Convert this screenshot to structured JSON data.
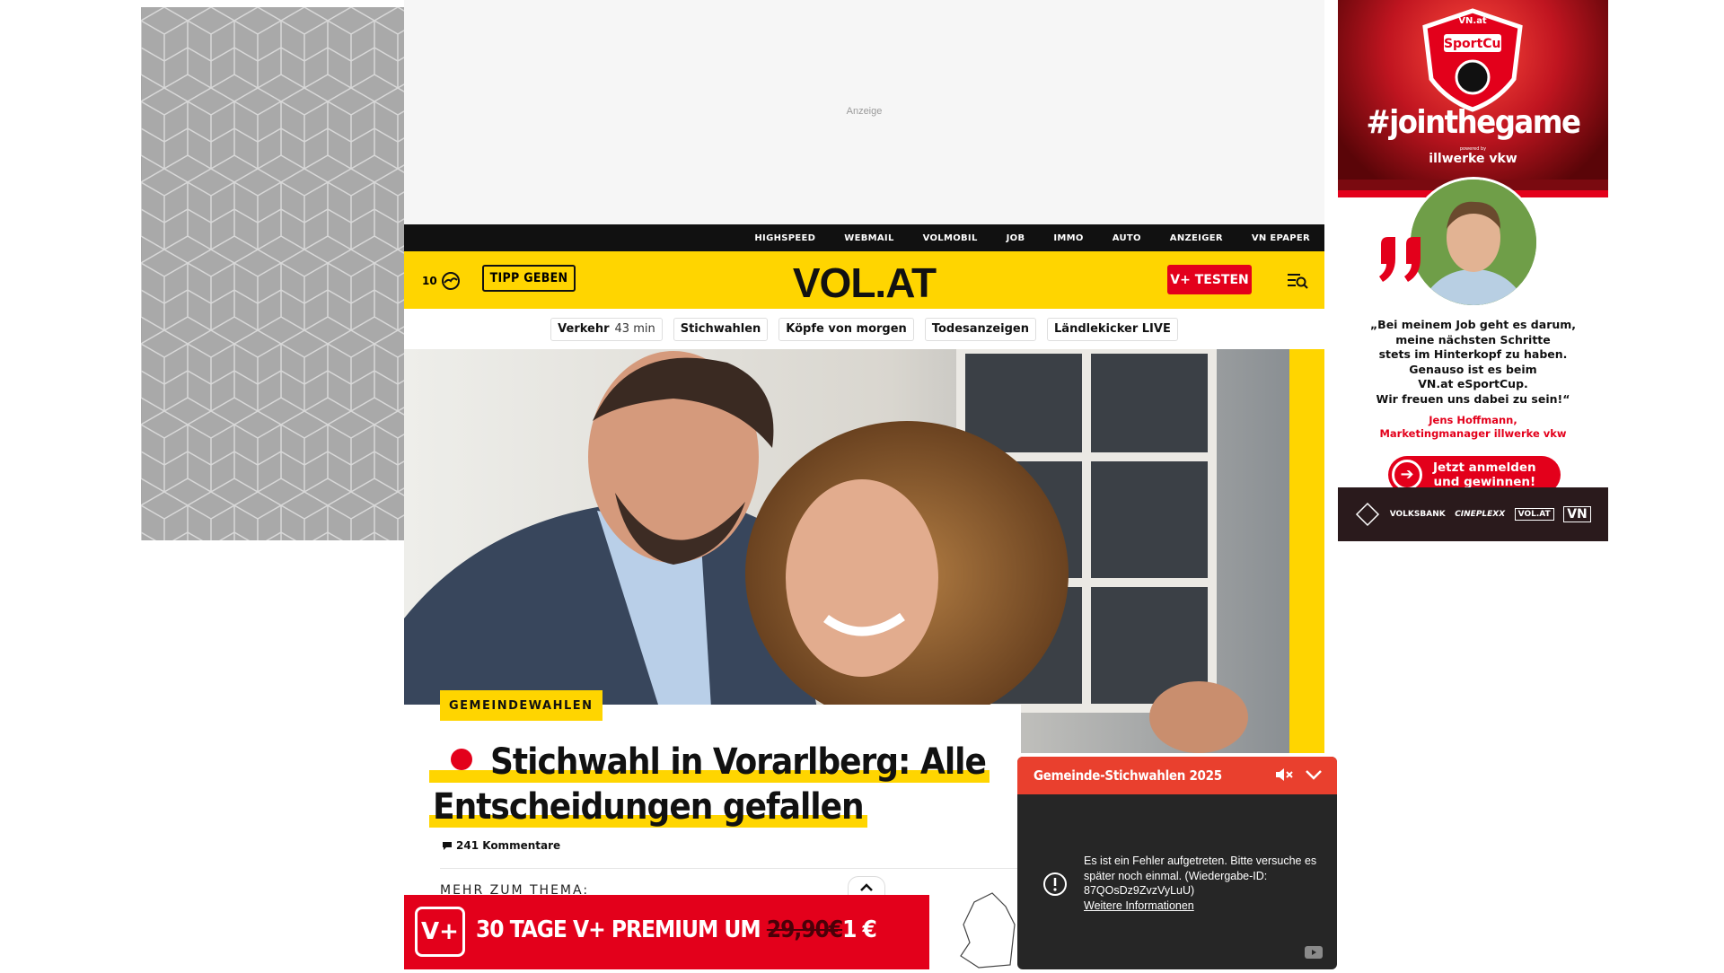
{
  "top_ad": {
    "label": "Anzeige"
  },
  "topnav": {
    "items": [
      "HIGHSPEED",
      "WEBMAIL",
      "VOLMOBIL",
      "JOB",
      "IMMO",
      "AUTO",
      "ANZEIGER",
      "VN EPAPER"
    ]
  },
  "header": {
    "temperature": "10",
    "weather_icon": "cloud-sun-icon",
    "tipp_label": "TIPP GEBEN",
    "logo": "VOL.AT",
    "vplus_label": "V+ TESTEN",
    "menu_icon": "menu-search-icon",
    "brand_yellow": "#ffd500",
    "brand_red": "#e3001b"
  },
  "chips": [
    {
      "label": "Verkehr",
      "sub": "43 min"
    },
    {
      "label": "Stichwahlen",
      "sub": ""
    },
    {
      "label": "Köpfe von morgen",
      "sub": ""
    },
    {
      "label": "Todesanzeigen",
      "sub": ""
    },
    {
      "label": "Ländlekicker LIVE",
      "sub": ""
    }
  ],
  "article": {
    "category": "GEMEINDEWAHLEN",
    "headline_line1": "Stichwahl in Vorarlberg: Alle",
    "headline_line2": "Entscheidungen gefallen",
    "live_indicator_color": "#e3001b",
    "comments": "241 Kommentare",
    "more_topic": "MEHR ZUM THEMA:"
  },
  "promo": {
    "badge": "V+",
    "text_before": "30 TAGE V+ PREMIUM UM ",
    "old_price": "29,90€",
    "new_price": "1 €"
  },
  "right_ad": {
    "brand": "VN.at",
    "event": "eSportCup",
    "hashtag": "#jointhegame",
    "powered_label": "powered by",
    "powered": "illwerke vkw",
    "quote_lines": [
      "„Bei meinem Job geht es darum,",
      "meine nächsten Schritte",
      "stets im Hinterkopf zu haben.",
      "Genauso ist es beim",
      "VN.at eSportCup.",
      "Wir freuen uns dabei zu sein!“"
    ],
    "author_line1": "Jens Hoffmann,",
    "author_line2": "Marketingmanager illwerke vkw",
    "cta_line1": "Jetzt anmelden",
    "cta_line2": "und gewinnen!",
    "sponsors": [
      "VOLKSBANK",
      "CINEPLEXX",
      "VOL.AT",
      "VN"
    ]
  },
  "video": {
    "title": "Gemeinde-Stichwahlen 2025",
    "error_text": "Es ist ein Fehler aufgetreten. Bitte versuche es später noch einmal. (Wiedergabe-ID: 87QOsDz9ZvzVyLuU)",
    "error_link": "Weitere Informationen",
    "header_color": "#e9402e"
  }
}
